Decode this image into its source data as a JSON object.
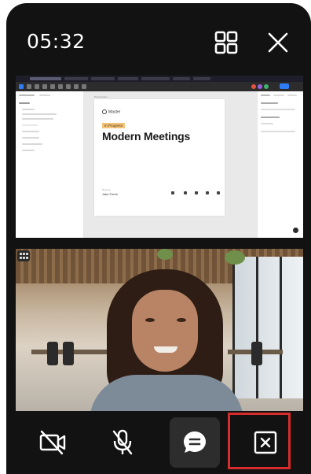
{
  "call": {
    "timer": "05:32"
  },
  "topbar_icons": {
    "grid": "grid-view-icon",
    "close": "close-icon"
  },
  "shared_screen": {
    "frame_label": "Master",
    "status_badge": "In Progress",
    "title": "Modern Meetings",
    "presenter_caption": "Presenter",
    "presenter_name": "Jake Ferris"
  },
  "controls": {
    "camera_icon": "camera-off-icon",
    "mic_icon": "microphone-off-icon",
    "chat_icon": "chat-icon",
    "end_icon": "end-call-icon"
  },
  "colors": {
    "background": "#121212",
    "highlight": "#d82b2b",
    "badge": "#f3c37a"
  }
}
